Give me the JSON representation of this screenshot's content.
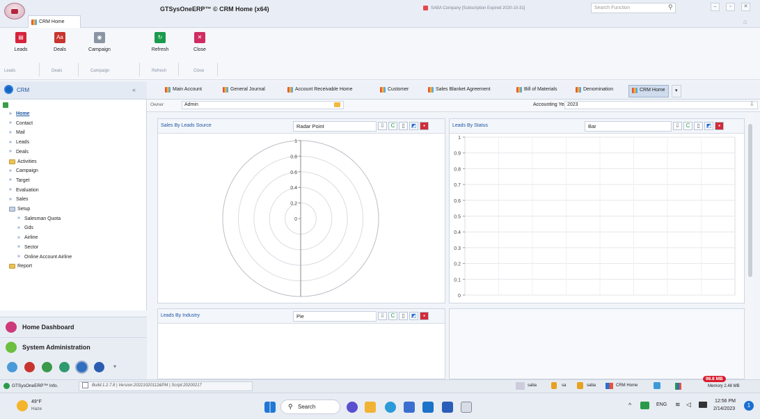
{
  "window": {
    "title": "GTSysOneERP™ © CRM Home (x64)",
    "app_tab": "CRM Home",
    "company": "SABA Company [Subscription Expired 2020-10-31]",
    "search_placeholder": "Search Function"
  },
  "ribbon": {
    "buttons": [
      {
        "label": "Leads",
        "icon": "leads-icon",
        "group": "Leads",
        "color": "#d6243b"
      },
      {
        "label": "Deals",
        "icon": "deals-icon",
        "group": "Deals",
        "color": "#c8342e"
      },
      {
        "label": "Campaign",
        "icon": "campaign-icon",
        "group": "Campaign",
        "color": "#8a95a3"
      },
      {
        "label": "Refresh",
        "icon": "refresh-icon",
        "group": "Refresh",
        "color": "#1a9a4c"
      },
      {
        "label": "Close",
        "icon": "close-icon",
        "group": "Close",
        "color": "#d02c63"
      }
    ]
  },
  "sidebar": {
    "header": "CRM",
    "items": [
      {
        "label": "Home",
        "icon": "arrow",
        "indent": 0,
        "active": true
      },
      {
        "label": "Contact",
        "icon": "arrow",
        "indent": 0
      },
      {
        "label": "Mail",
        "icon": "arrow",
        "indent": 0
      },
      {
        "label": "Leads",
        "icon": "arrow",
        "indent": 0
      },
      {
        "label": "Deals",
        "icon": "arrow",
        "indent": 0
      },
      {
        "label": "Activities",
        "icon": "folder",
        "indent": 0
      },
      {
        "label": "Campaign",
        "icon": "arrow",
        "indent": 0
      },
      {
        "label": "Target",
        "icon": "arrow",
        "indent": 0
      },
      {
        "label": "Evaluation",
        "icon": "arrow",
        "indent": 0
      },
      {
        "label": "Sales",
        "icon": "arrow",
        "indent": 0
      },
      {
        "label": "Setup",
        "icon": "setup",
        "indent": 0
      },
      {
        "label": "Salesman Quota",
        "icon": "arrow",
        "indent": 1
      },
      {
        "label": "Gds",
        "icon": "arrow",
        "indent": 1
      },
      {
        "label": "Airline",
        "icon": "arrow",
        "indent": 1
      },
      {
        "label": "Sector",
        "icon": "arrow",
        "indent": 1
      },
      {
        "label": "Online Account Airline",
        "icon": "arrow",
        "indent": 1
      },
      {
        "label": "Report",
        "icon": "folder",
        "indent": 0
      }
    ],
    "nav": [
      {
        "label": "Home Dashboard",
        "color": "#cc3a7a"
      },
      {
        "label": "System Administration",
        "color": "#6cbf3f"
      }
    ],
    "modules": [
      "#4a9ad8",
      "#c8342e",
      "#3a9a4a",
      "#2f9a6f",
      "#2f6fc0",
      "#2a5db0"
    ]
  },
  "tabs": [
    "Main Account",
    "General Journal",
    "Account Receivable Home",
    "Customer",
    "Sales Blanket Agreement",
    "Bill of Materials",
    "Denomination",
    "CRM Home"
  ],
  "active_tab": "CRM Home",
  "filters": {
    "owner_label": "Owner",
    "owner_value": "Admin",
    "year_label": "Accounting Year",
    "year_value": "2023"
  },
  "panels": {
    "leads_source": {
      "title": "Sales By Leads Source",
      "chart_type": "Radar Point"
    },
    "leads_status": {
      "title": "Leads By Status",
      "chart_type": "Bar"
    },
    "leads_industry": {
      "title": "Leads By Industry",
      "chart_type": "Pie"
    }
  },
  "chart_data": [
    {
      "type": "radar",
      "title": "Sales By Leads Source",
      "radial_ticks": [
        "1",
        "0.8",
        "0.6",
        "0.4",
        "0.2",
        "0"
      ],
      "series": []
    },
    {
      "type": "bar",
      "title": "Leads By Status",
      "y_ticks": [
        "1",
        "0.9",
        "0.8",
        "0.7",
        "0.6",
        "0.5",
        "0.4",
        "0.3",
        "0.2",
        "0.1",
        "0"
      ],
      "ylim": [
        0,
        1
      ],
      "grid": true,
      "categories": [],
      "values": []
    }
  ],
  "statusbar": {
    "app": "GTSysOneERP™ Info.",
    "build": "Build:1.2.7.8 | Version:20221020112&PM | Script:20200217",
    "user1": "saba",
    "user2": "sa",
    "user3": "saba",
    "module": "CRM Home",
    "memory_badge": "98.8 MB",
    "memory_label": "Memory 2.48 MB"
  },
  "taskbar": {
    "weather_temp": "49°F",
    "weather_desc": "Haze",
    "search": "Search",
    "lang": "ENG",
    "time": "12:56 PM",
    "date": "2/14/2023",
    "notification_count": "1"
  }
}
